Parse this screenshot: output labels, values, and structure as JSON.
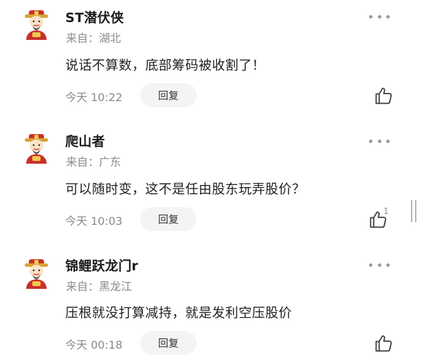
{
  "comments": [
    {
      "username": "ST潜伏侠",
      "location": "来自：湖北",
      "content": "说话不算数，底部筹码被收割了！",
      "time": "今天 10:22",
      "reply_label": "回复",
      "like_count": ""
    },
    {
      "username": "爬山者",
      "location": "来自：广东",
      "content": "可以随时变，这不是任由股东玩弄股价？",
      "time": "今天 10:03",
      "reply_label": "回复",
      "like_count": "1"
    },
    {
      "username": "锦鲤跃龙门r",
      "location": "来自：黑龙江",
      "content": "压根就没打算减持，就是发利空压股价",
      "time": "今天 00:18",
      "reply_label": "回复",
      "like_count": ""
    }
  ],
  "icons": {
    "avatar": "caishen-avatar-icon",
    "more": "more-dots-icon",
    "like": "thumbs-up-icon"
  },
  "colors": {
    "text_primary": "#1a1a1a",
    "text_secondary": "#8a8a8a",
    "reply_bg": "#f4f4f4",
    "icon_gray": "#9a9a9a"
  }
}
